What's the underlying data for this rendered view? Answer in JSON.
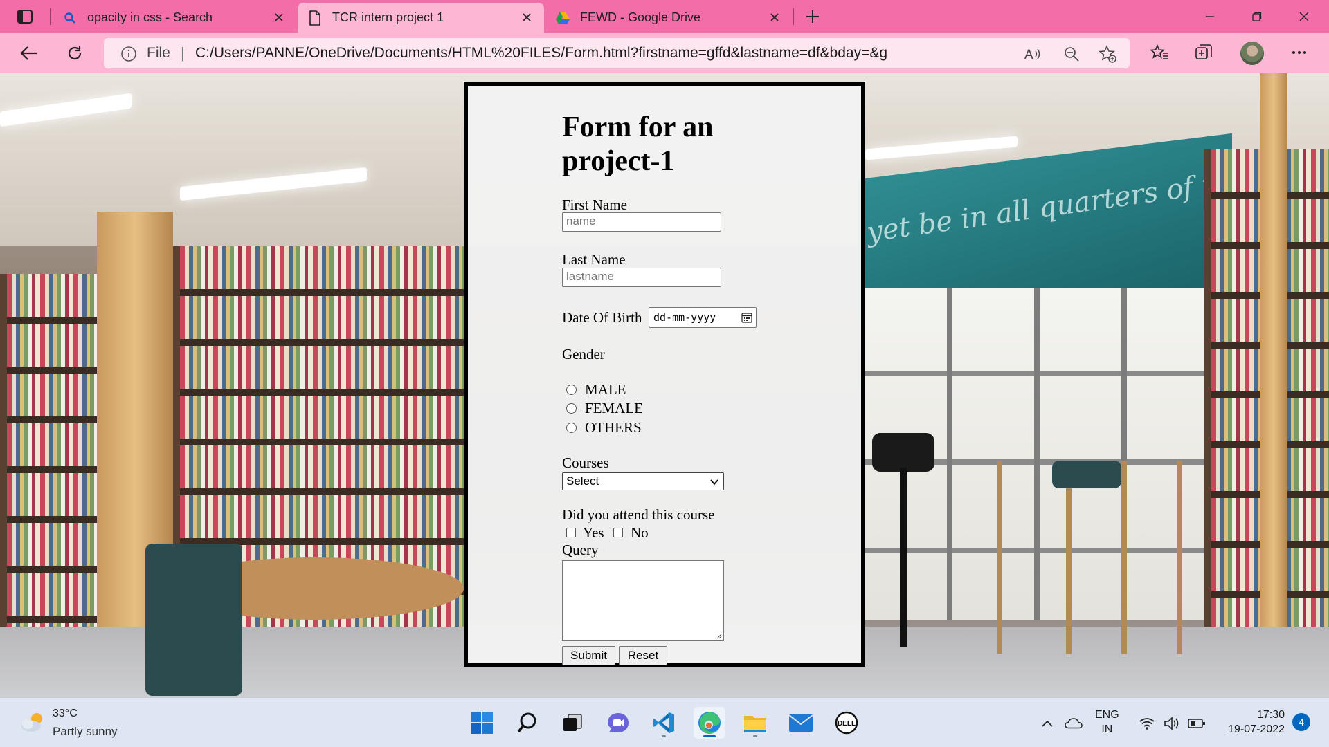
{
  "browser": {
    "tabs": [
      {
        "title": "opacity in css - Search",
        "icon": "search-icon",
        "active": false
      },
      {
        "title": "TCR intern project 1",
        "icon": "page-icon",
        "active": true
      },
      {
        "title": "FEWD - Google Drive",
        "icon": "google-drive-icon",
        "active": false
      }
    ],
    "address": {
      "scheme_label": "File",
      "url": "C:/Users/PANNE/OneDrive/Documents/HTML%20FILES/Form.html?firstname=gffd&lastname=df&bday=&gender=FEMALE&..."
    }
  },
  "page": {
    "backdrop_text": "yet be in all quarters of the eart",
    "form": {
      "title": "Form for an project-1",
      "first_name": {
        "label": "First Name",
        "placeholder": "name"
      },
      "last_name": {
        "label": "Last Name",
        "placeholder": "lastname"
      },
      "dob": {
        "label": "Date Of Birth",
        "placeholder": "dd-mm-yyyy"
      },
      "gender": {
        "label": "Gender",
        "options": [
          "MALE",
          "FEMALE",
          "OTHERS"
        ]
      },
      "courses": {
        "label": "Courses",
        "selected": "Select"
      },
      "attended": {
        "label": "Did you attend this course",
        "options": [
          "Yes",
          "No"
        ]
      },
      "query": {
        "label": "Query"
      },
      "submit_label": "Submit",
      "reset_label": "Reset"
    }
  },
  "taskbar": {
    "weather": {
      "temp": "33°C",
      "desc": "Partly sunny"
    },
    "apps": [
      "start-icon",
      "search-icon",
      "task-view-icon",
      "teams-chat-icon",
      "vscode-icon",
      "edge-icon",
      "file-explorer-icon",
      "mail-icon",
      "dell-icon"
    ],
    "language": {
      "line1": "ENG",
      "line2": "IN"
    },
    "time": "17:30",
    "date": "19-07-2022",
    "notification_count": "4"
  }
}
